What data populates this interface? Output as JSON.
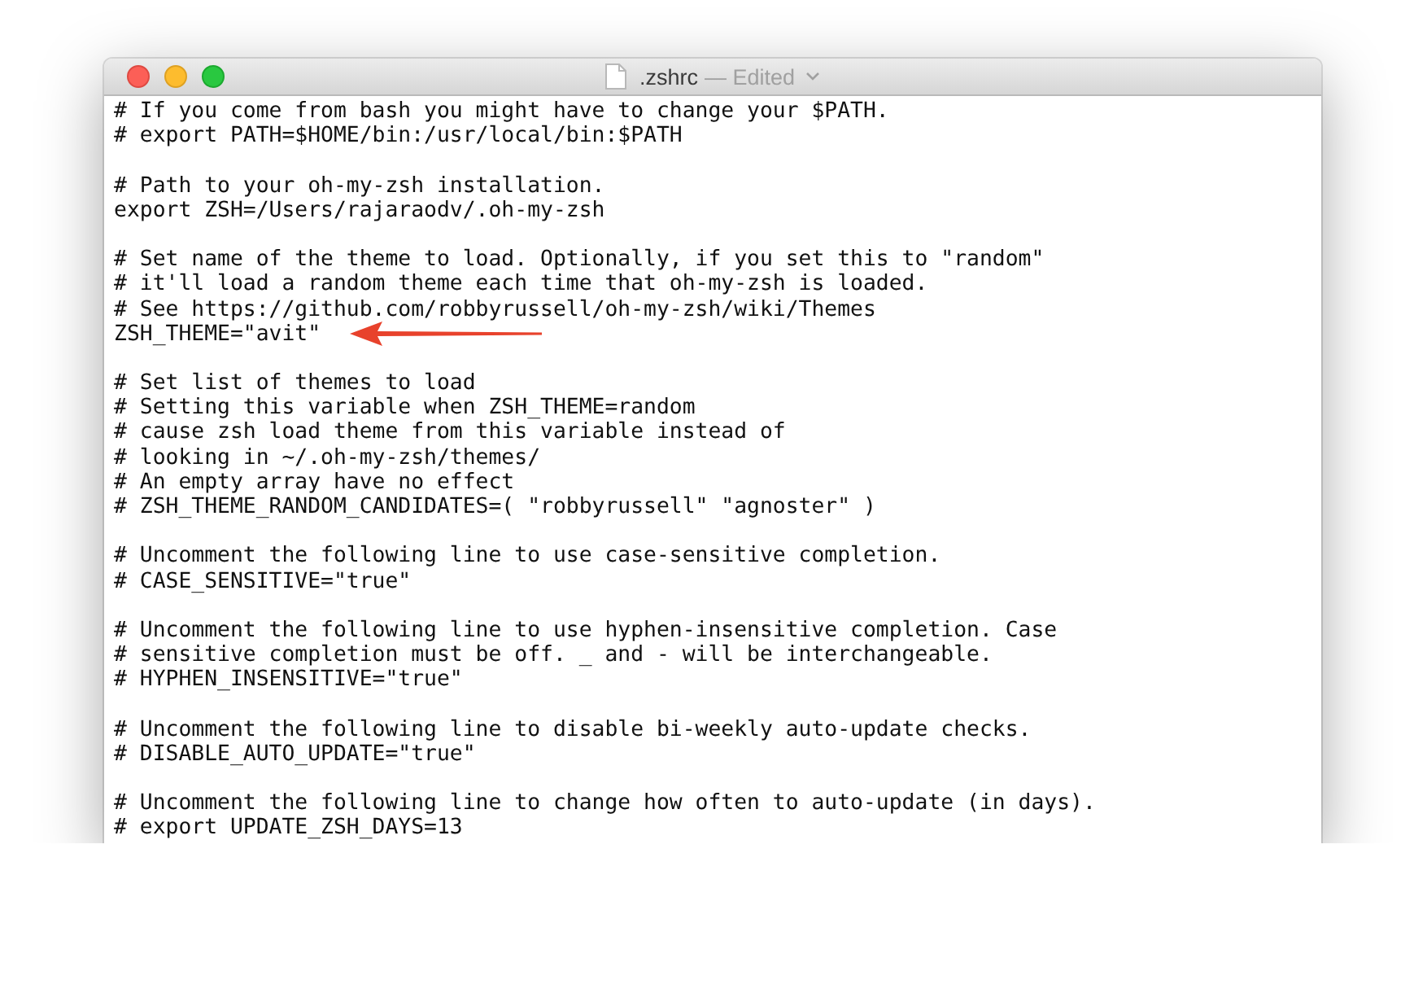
{
  "window": {
    "title": ".zshrc",
    "status": "— Edited"
  },
  "lines": [
    {
      "kind": "code",
      "text": "# If you come from bash you might have to change your $PATH."
    },
    {
      "kind": "code",
      "text": "# export PATH=$HOME/bin:/usr/local/bin:$PATH"
    },
    {
      "kind": "blank"
    },
    {
      "kind": "code",
      "text": "# Path to your oh-my-zsh installation."
    },
    {
      "kind": "code",
      "text": "export ZSH=/Users/rajaraodv/.oh-my-zsh"
    },
    {
      "kind": "blank"
    },
    {
      "kind": "code",
      "text": "# Set name of the theme to load. Optionally, if you set this to \"random\""
    },
    {
      "kind": "code",
      "text": "# it'll load a random theme each time that oh-my-zsh is loaded."
    },
    {
      "kind": "code",
      "text": "# See https://github.com/robbyrussell/oh-my-zsh/wiki/Themes"
    },
    {
      "kind": "arrowed",
      "text": "ZSH_THEME=\"avit\""
    },
    {
      "kind": "blank"
    },
    {
      "kind": "code",
      "text": "# Set list of themes to load"
    },
    {
      "kind": "code",
      "text": "# Setting this variable when ZSH_THEME=random"
    },
    {
      "kind": "code",
      "text": "# cause zsh load theme from this variable instead of"
    },
    {
      "kind": "code",
      "text": "# looking in ~/.oh-my-zsh/themes/"
    },
    {
      "kind": "code",
      "text": "# An empty array have no effect"
    },
    {
      "kind": "code",
      "text": "# ZSH_THEME_RANDOM_CANDIDATES=( \"robbyrussell\" \"agnoster\" )"
    },
    {
      "kind": "blank"
    },
    {
      "kind": "code",
      "text": "# Uncomment the following line to use case-sensitive completion."
    },
    {
      "kind": "code",
      "text": "# CASE_SENSITIVE=\"true\""
    },
    {
      "kind": "blank"
    },
    {
      "kind": "code",
      "text": "# Uncomment the following line to use hyphen-insensitive completion. Case"
    },
    {
      "kind": "code",
      "text": "# sensitive completion must be off. _ and - will be interchangeable."
    },
    {
      "kind": "code",
      "text": "# HYPHEN_INSENSITIVE=\"true\""
    },
    {
      "kind": "blank"
    },
    {
      "kind": "code",
      "text": "# Uncomment the following line to disable bi-weekly auto-update checks."
    },
    {
      "kind": "code",
      "text": "# DISABLE_AUTO_UPDATE=\"true\""
    },
    {
      "kind": "blank"
    },
    {
      "kind": "code",
      "text": "# Uncomment the following line to change how often to auto-update (in days)."
    },
    {
      "kind": "code",
      "text": "# export UPDATE_ZSH_DAYS=13"
    }
  ]
}
